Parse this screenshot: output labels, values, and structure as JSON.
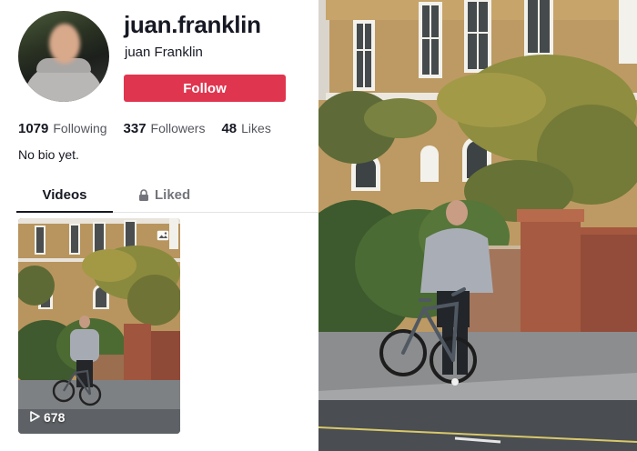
{
  "profile": {
    "username": "juan.franklin",
    "display_name": "juan Franklin",
    "follow_label": "Follow",
    "stats": [
      {
        "value": "1079",
        "label": "Following"
      },
      {
        "value": "337",
        "label": "Followers"
      },
      {
        "value": "48",
        "label": "Likes"
      }
    ],
    "bio": "No bio yet."
  },
  "tabs": {
    "videos_label": "Videos",
    "liked_label": "Liked"
  },
  "video_card": {
    "views": "678",
    "icons": [
      "play-icon",
      "photo-carousel-icon"
    ]
  },
  "colors": {
    "follow_button": "#e0354f",
    "text_primary": "#161823",
    "text_secondary": "#54565e"
  }
}
